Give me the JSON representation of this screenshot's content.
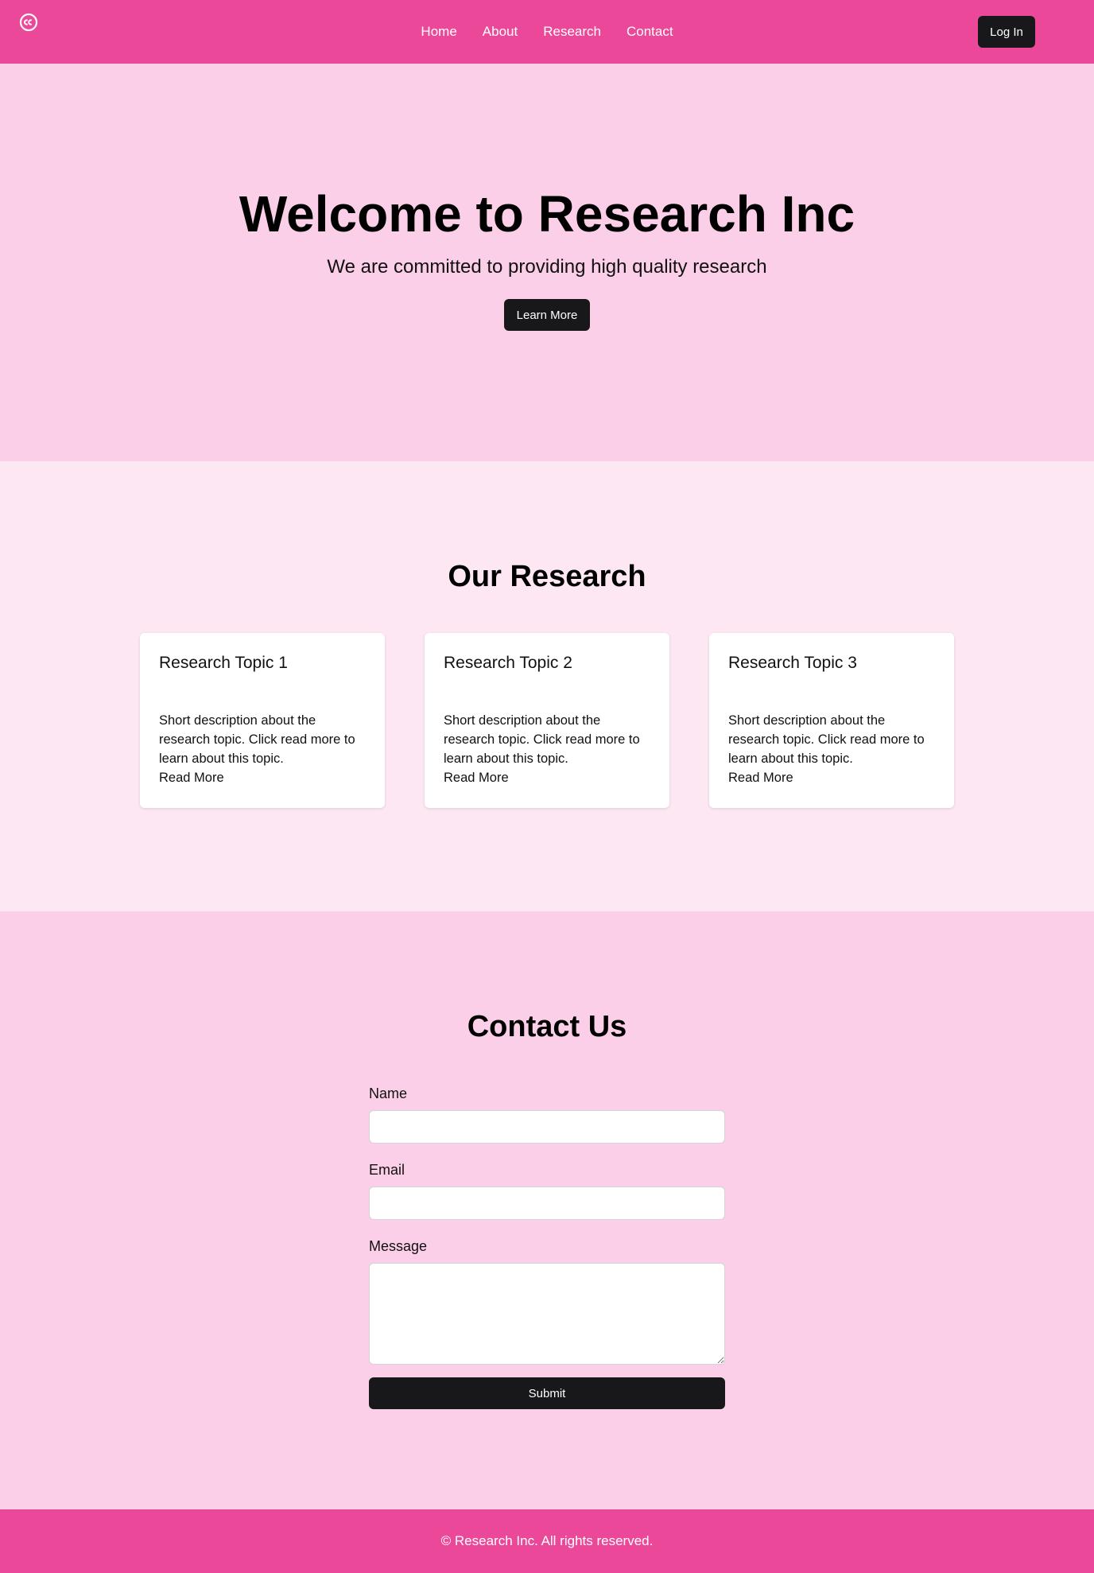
{
  "header": {
    "logo_icon": "creative-commons-icon",
    "nav": [
      {
        "label": "Home"
      },
      {
        "label": "About"
      },
      {
        "label": "Research"
      },
      {
        "label": "Contact"
      }
    ],
    "login_label": "Log In"
  },
  "hero": {
    "title": "Welcome to Research Inc",
    "subtitle": "We are committed to providing high quality research",
    "cta_label": "Learn More"
  },
  "research": {
    "title": "Our Research",
    "cards": [
      {
        "title": "Research Topic 1",
        "description": "Short description about the research topic. Click read more to learn about this topic.",
        "link": "Read More"
      },
      {
        "title": "Research Topic 2",
        "description": "Short description about the research topic. Click read more to learn about this topic.",
        "link": "Read More"
      },
      {
        "title": "Research Topic 3",
        "description": "Short description about the research topic. Click read more to learn about this topic.",
        "link": "Read More"
      }
    ]
  },
  "contact": {
    "title": "Contact Us",
    "name_label": "Name",
    "name_value": "",
    "email_label": "Email",
    "email_value": "",
    "message_label": "Message",
    "message_value": "",
    "submit_label": "Submit"
  },
  "footer": {
    "text": "© Research Inc. All rights reserved."
  },
  "colors": {
    "brand": "#ec4899",
    "hero_bg": "#fbcfe8",
    "section_bg": "#fce7f3",
    "button": "#18181b"
  }
}
